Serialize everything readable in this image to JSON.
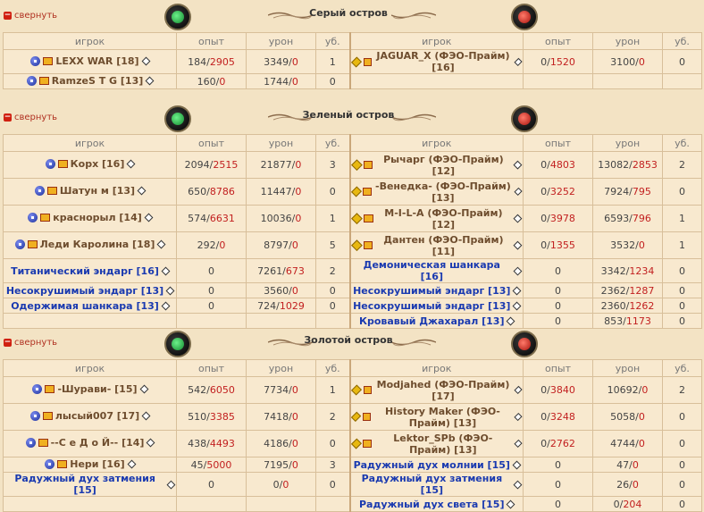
{
  "collapse_label": "свернуть",
  "headers": [
    "игрок",
    "опыт",
    "урон",
    "уб."
  ],
  "sections": [
    {
      "title": "Серый остров",
      "rows": [
        {
          "tall": false,
          "left": {
            "name": "LEXX WAR [18]",
            "type": "player",
            "exp": "184",
            "exp_max": "2905",
            "dmg": "3349",
            "dmg_x": "0",
            "kills": "1"
          },
          "right": {
            "name": "JAGUAR_X (ФЭО-Прайм) [16]",
            "type": "player",
            "exp": "0",
            "exp_max": "1520",
            "dmg": "3100",
            "dmg_x": "0",
            "kills": "0"
          }
        },
        {
          "tall": false,
          "left": {
            "name": "RamzeS T G [13]",
            "type": "player",
            "exp": "160",
            "exp_max": "0",
            "dmg": "1744",
            "dmg_x": "0",
            "kills": "0"
          },
          "right": null
        }
      ]
    },
    {
      "title": "Зеленый остров",
      "rows": [
        {
          "tall": true,
          "left": {
            "name": "Корх [16]",
            "type": "player",
            "exp": "2094",
            "exp_max": "2515",
            "dmg": "21877",
            "dmg_x": "0",
            "kills": "3"
          },
          "right": {
            "name": "Рычарг (ФЭО-Прайм) [12]",
            "type": "player",
            "exp": "0",
            "exp_max": "4803",
            "dmg": "13082",
            "dmg_x": "2853",
            "kills": "2"
          }
        },
        {
          "tall": true,
          "left": {
            "name": "Шатун м [13]",
            "type": "player",
            "exp": "650",
            "exp_max": "8786",
            "dmg": "11447",
            "dmg_x": "0",
            "kills": "0"
          },
          "right": {
            "name": "-Венедка- (ФЭО-Прайм) [13]",
            "type": "player",
            "exp": "0",
            "exp_max": "3252",
            "dmg": "7924",
            "dmg_x": "795",
            "kills": "0"
          }
        },
        {
          "tall": true,
          "left": {
            "name": "краснорыл [14]",
            "type": "player",
            "exp": "574",
            "exp_max": "6631",
            "dmg": "10036",
            "dmg_x": "0",
            "kills": "1"
          },
          "right": {
            "name": "M-I-L-A (ФЭО-Прайм) [12]",
            "type": "player",
            "exp": "0",
            "exp_max": "3978",
            "dmg": "6593",
            "dmg_x": "796",
            "kills": "1"
          }
        },
        {
          "tall": true,
          "left": {
            "name": "Леди Каролина [18]",
            "type": "player",
            "exp": "292",
            "exp_max": "0",
            "dmg": "8797",
            "dmg_x": "0",
            "kills": "5"
          },
          "right": {
            "name": "Дантен (ФЭО-Прайм) [11]",
            "type": "player",
            "exp": "0",
            "exp_max": "1355",
            "dmg": "3532",
            "dmg_x": "0",
            "kills": "1"
          }
        },
        {
          "tall": false,
          "left": {
            "name": "Титанический эндарг [16]",
            "type": "bot",
            "exp": "0",
            "exp_max": null,
            "dmg": "7261",
            "dmg_x": "673",
            "kills": "2"
          },
          "right": {
            "name": "Демоническая шанкара [16]",
            "type": "bot",
            "exp": "0",
            "exp_max": null,
            "dmg": "3342",
            "dmg_x": "1234",
            "kills": "0"
          }
        },
        {
          "tall": false,
          "left": {
            "name": "Несокрушимый эндарг [13]",
            "type": "bot",
            "exp": "0",
            "exp_max": null,
            "dmg": "3560",
            "dmg_x": "0",
            "kills": "0"
          },
          "right": {
            "name": "Несокрушимый эндарг [13]",
            "type": "bot",
            "exp": "0",
            "exp_max": null,
            "dmg": "2362",
            "dmg_x": "1287",
            "kills": "0"
          }
        },
        {
          "tall": false,
          "left": {
            "name": "Одержимая шанкара [13]",
            "type": "bot",
            "exp": "0",
            "exp_max": null,
            "dmg": "724",
            "dmg_x": "1029",
            "kills": "0"
          },
          "right": {
            "name": "Несокрушимый эндарг [13]",
            "type": "bot",
            "exp": "0",
            "exp_max": null,
            "dmg": "2360",
            "dmg_x": "1262",
            "kills": "0"
          }
        },
        {
          "tall": false,
          "left": null,
          "right": {
            "name": "Кровавый Джахарал [13]",
            "type": "bot",
            "exp": "0",
            "exp_max": null,
            "dmg": "853",
            "dmg_x": "1173",
            "kills": "0"
          }
        }
      ]
    },
    {
      "title": "Золотой остров",
      "rows": [
        {
          "tall": true,
          "left": {
            "name": "-Шурави- [15]",
            "type": "player",
            "exp": "542",
            "exp_max": "6050",
            "dmg": "7734",
            "dmg_x": "0",
            "kills": "1"
          },
          "right": {
            "name": "Modjahed (ФЭО-Прайм) [17]",
            "type": "player",
            "exp": "0",
            "exp_max": "3840",
            "dmg": "10692",
            "dmg_x": "0",
            "kills": "2"
          }
        },
        {
          "tall": true,
          "left": {
            "name": "лысый007 [17]",
            "type": "player",
            "exp": "510",
            "exp_max": "3385",
            "dmg": "7418",
            "dmg_x": "0",
            "kills": "2"
          },
          "right": {
            "name": "History Maker (ФЭО-Прайм) [13]",
            "type": "player",
            "exp": "0",
            "exp_max": "3248",
            "dmg": "5058",
            "dmg_x": "0",
            "kills": "0"
          }
        },
        {
          "tall": true,
          "left": {
            "name": "--С е Д о Й-- [14]",
            "type": "player",
            "exp": "438",
            "exp_max": "4493",
            "dmg": "4186",
            "dmg_x": "0",
            "kills": "0"
          },
          "right": {
            "name": "Lektor_SPb (ФЭО-Прайм) [13]",
            "type": "player",
            "exp": "0",
            "exp_max": "2762",
            "dmg": "4744",
            "dmg_x": "0",
            "kills": "0"
          }
        },
        {
          "tall": false,
          "left": {
            "name": "Нери [16]",
            "type": "player",
            "exp": "45",
            "exp_max": "5000",
            "dmg": "7195",
            "dmg_x": "0",
            "kills": "3"
          },
          "right": {
            "name": "Радужный дух молнии  [15]",
            "type": "bot",
            "exp": "0",
            "exp_max": null,
            "dmg": "47",
            "dmg_x": "0",
            "kills": "0"
          }
        },
        {
          "tall": false,
          "left": {
            "name": "Радужный дух затмения  [15]",
            "type": "bot",
            "exp": "0",
            "exp_max": null,
            "dmg": "0",
            "dmg_x": "0",
            "kills": "0"
          },
          "right": {
            "name": "Радужный дух затмения  [15]",
            "type": "bot",
            "exp": "0",
            "exp_max": null,
            "dmg": "26",
            "dmg_x": "0",
            "kills": "0"
          }
        },
        {
          "tall": false,
          "left": null,
          "right": {
            "name": "Радужный дух света  [15]",
            "type": "bot",
            "exp": "0",
            "exp_max": null,
            "dmg": "0",
            "dmg_x": "204",
            "kills": "0"
          }
        }
      ]
    }
  ]
}
